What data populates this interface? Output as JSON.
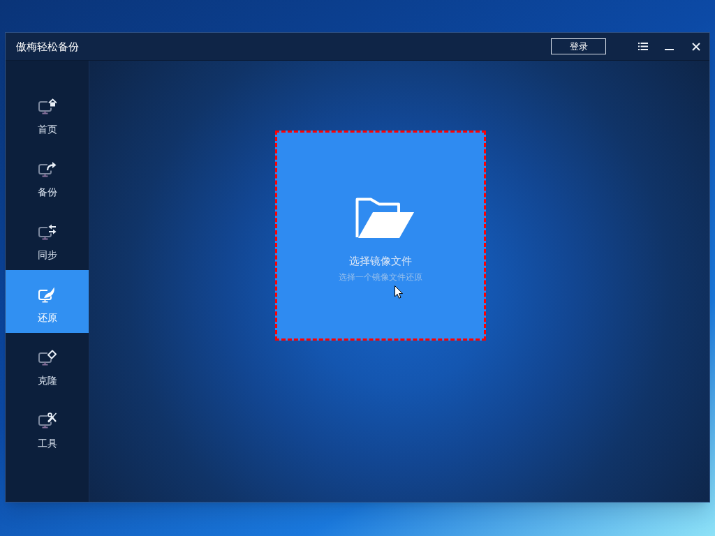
{
  "window": {
    "title": "傲梅轻松备份",
    "login_button": "登录"
  },
  "sidebar": {
    "items": [
      {
        "kind": "home",
        "label": "首页",
        "selected": false
      },
      {
        "kind": "backup",
        "label": "备份",
        "selected": false
      },
      {
        "kind": "sync",
        "label": "同步",
        "selected": false
      },
      {
        "kind": "restore",
        "label": "还原",
        "selected": true
      },
      {
        "kind": "clone",
        "label": "克隆",
        "selected": false
      },
      {
        "kind": "tools",
        "label": "工具",
        "selected": false
      }
    ]
  },
  "drop_zone": {
    "title": "选择镜像文件",
    "subtitle": "选择一个镜像文件还原",
    "highlighted": true
  }
}
